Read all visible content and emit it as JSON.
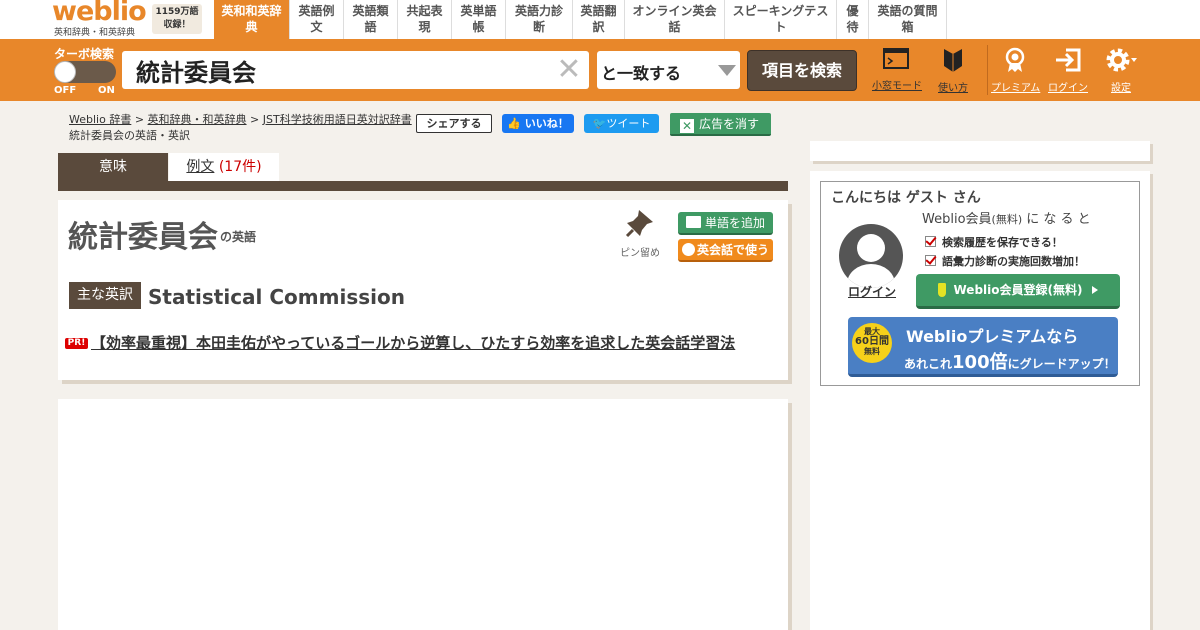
{
  "logo": {
    "wordmark": "weblio",
    "sub": "英和辞典・和英辞典",
    "count_line1": "1159万語",
    "count_line2": "収録！"
  },
  "nav": [
    {
      "line1": "英和和英辞",
      "line2": "典",
      "active": true
    },
    {
      "line1": "英語例",
      "line2": "文"
    },
    {
      "line1": "英語類",
      "line2": "語"
    },
    {
      "line1": "共起表",
      "line2": "現"
    },
    {
      "line1": "英単語",
      "line2": "帳"
    },
    {
      "line1": "英語力診",
      "line2": "断"
    },
    {
      "line1": "英語翻",
      "line2": "訳"
    },
    {
      "line1": "オンライン英会",
      "line2": "話"
    },
    {
      "line1": "スピーキングテス",
      "line2": "ト"
    },
    {
      "line1": "優",
      "line2": "待"
    },
    {
      "line1": "英語の質問",
      "line2": "箱"
    }
  ],
  "search": {
    "turbo_label": "ターボ検索",
    "turbo_off": "OFF",
    "turbo_on": "ON",
    "query": "統計委員会",
    "match_mode": "と一致する",
    "button": "項目を検索"
  },
  "header_buttons": {
    "kotai": "小窓モード",
    "howto": "使い方",
    "premium": "プレミアム",
    "login": "ログイン",
    "settings": "設定"
  },
  "breadcrumb": {
    "items": [
      "Weblio 辞書",
      "英和辞典・和英辞典",
      "JST科学技術用語日英対訳辞書"
    ],
    "separator": ">",
    "current": "統計委員会の英語・英訳"
  },
  "social": {
    "share": "シェアする",
    "like": "いいね！",
    "tweet": "ツイート",
    "hide_ads": "広告を消す"
  },
  "tabs": {
    "meaning": "意味",
    "examples": "例文",
    "examples_count": "(17件)"
  },
  "entry": {
    "headword": "統計委員会",
    "suffix": "の英語",
    "pin_label": "ピン留め",
    "add_word": "単語を追加",
    "eikaiwa": "英会話で使う",
    "main_badge": "主な英訳",
    "main_translation": "Statistical Commission",
    "pr_badge": "PR!",
    "pr_text": "【効率最重視】本田圭佑がやっているゴールから逆算し、ひたすら効率を追求した英会話学習法"
  },
  "sidebar": {
    "greeting": "こんにちは ゲスト さん",
    "member_lead_a": "Weblio会員",
    "member_lead_b": "(無料)",
    "member_lead_c": " に な る と",
    "login": "ログイン",
    "benefit1": "検索履歴を保存できる！",
    "benefit2": "語彙力診断の実施回数増加！",
    "register": "Weblio会員登録(無料)",
    "premium_badge_a": "最大",
    "premium_badge_b": "60日間",
    "premium_badge_c": "無料",
    "premium_line1": "Weblioプレミアムなら",
    "premium_line2_a": "あれこれ",
    "premium_line2_b": "100倍",
    "premium_line2_c": "にグレードアップ！"
  },
  "colors": {
    "brand_orange": "#e8872a",
    "dark_brown": "#5a4a3c",
    "green": "#3f9a64",
    "link_red": "#cc0000"
  }
}
